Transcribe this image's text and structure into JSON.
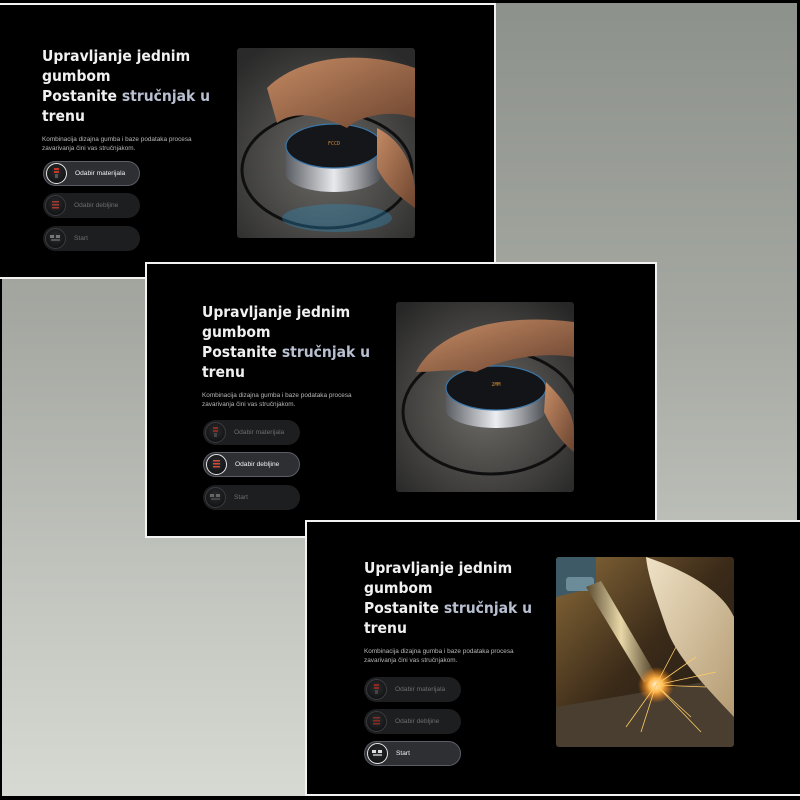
{
  "slides": [
    {
      "title_line1": "Upravljanje jednim",
      "title_line2": "gumbom",
      "title_line3a": "Postanite ",
      "title_line3b": "stručnjak u",
      "title_line4": "trenu",
      "description": "Kombinacija dizajna gumba i baze podataka procesa zavarivanja čini vas stručnjakom.",
      "buttons": [
        "Odabir materijala",
        "Odabir debljine",
        "Start"
      ],
      "active_index": 0,
      "image": "hand-on-rotary-knob"
    },
    {
      "title_line1": "Upravljanje jednim",
      "title_line2": "gumbom",
      "title_line3a": "Postanite ",
      "title_line3b": "stručnjak u",
      "title_line4": "trenu",
      "description": "Kombinacija dizajna gumba i baze podataka procesa zavarivanja čini vas stručnjakom.",
      "buttons": [
        "Odabir materijala",
        "Odabir debljine",
        "Start"
      ],
      "active_index": 1,
      "image": "hand-on-rotary-knob"
    },
    {
      "title_line1": "Upravljanje jednim",
      "title_line2": "gumbom",
      "title_line3a": "Postanite ",
      "title_line3b": "stručnjak u",
      "title_line4": "trenu",
      "description": "Kombinacija dizajna gumba i baze podataka procesa zavarivanja čini vas stručnjakom.",
      "buttons": [
        "Odabir materijala",
        "Odabir debljine",
        "Start"
      ],
      "active_index": 2,
      "image": "welding-torch-sparks"
    }
  ],
  "colors": {
    "panel_bg": "#000000",
    "accent_text": "#b8bfd0",
    "title_text": "#f1f1f1",
    "border": "#f2f2f2"
  }
}
